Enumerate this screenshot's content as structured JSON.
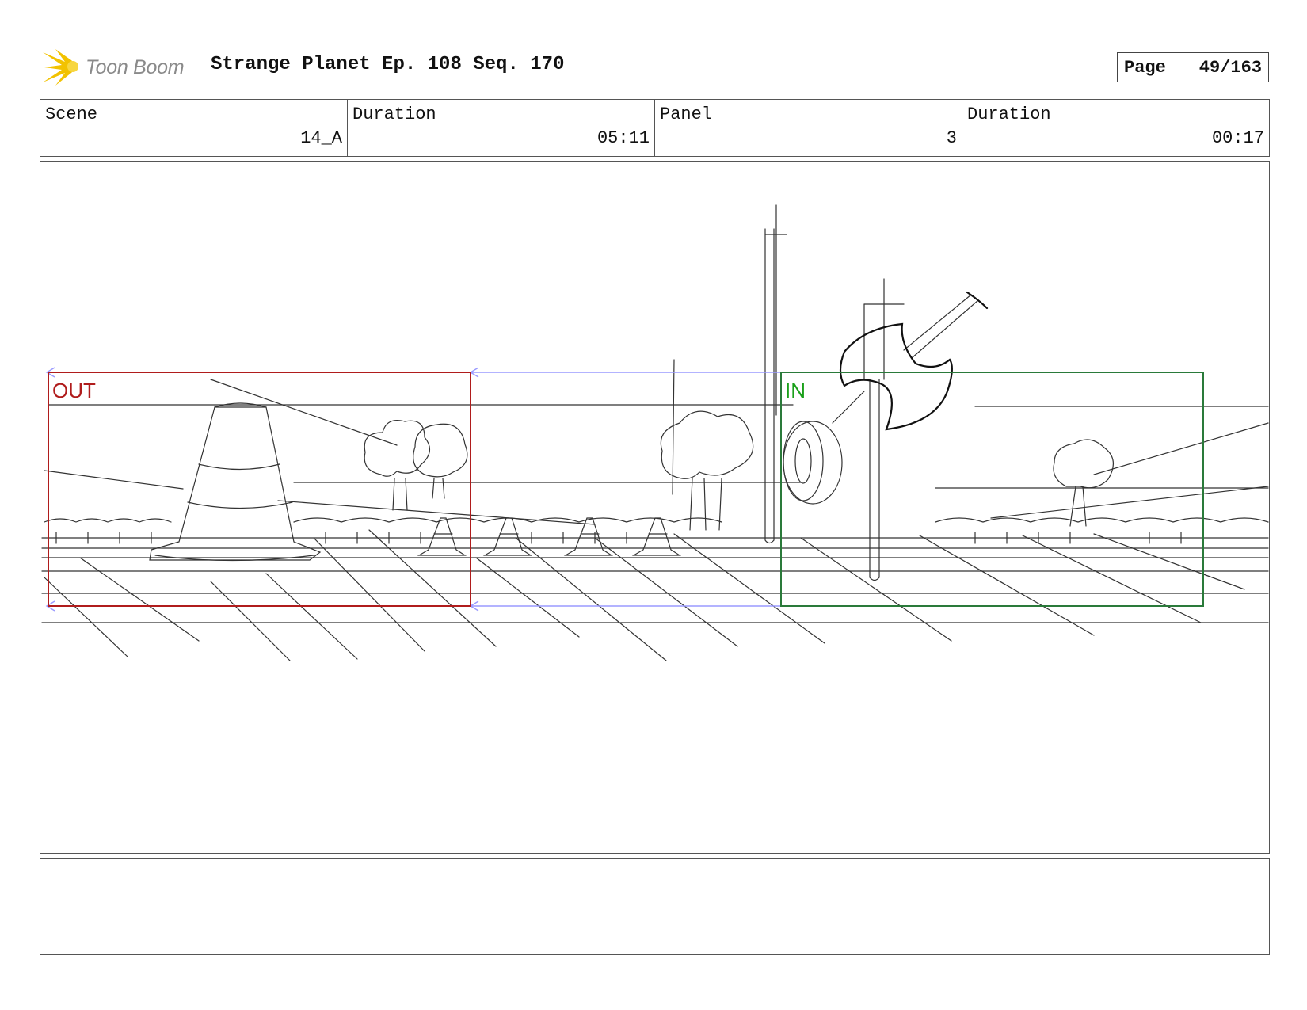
{
  "header": {
    "logo_text": "Toon Boom",
    "title": "Strange Planet Ep. 108 Seq. 170",
    "page_label": "Page",
    "page_value": "49/163"
  },
  "info": {
    "scene_label": "Scene",
    "scene_value": "14_A",
    "scene_duration_label": "Duration",
    "scene_duration_value": "05:11",
    "panel_label": "Panel",
    "panel_value": "3",
    "panel_duration_label": "Duration",
    "panel_duration_value": "00:17"
  },
  "panel": {
    "out_label": "OUT",
    "in_label": "IN",
    "colors": {
      "out": "#b01c1c",
      "in": "#2a7a3a",
      "in_text": "#1aa01a",
      "arrow": "#9a9aff"
    }
  },
  "notes": {
    "text": ""
  }
}
